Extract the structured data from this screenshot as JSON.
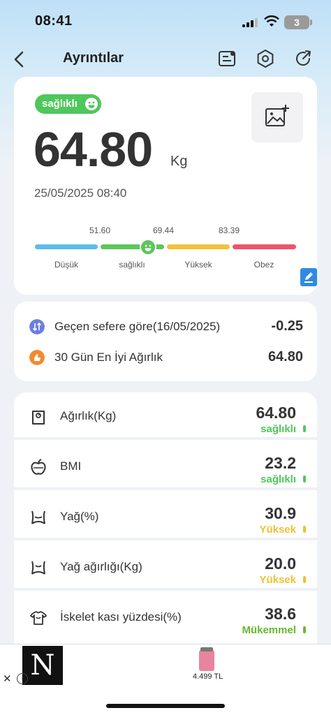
{
  "status_bar": {
    "time": "08:41",
    "battery": "3"
  },
  "nav": {
    "title": "Ayrıntılar"
  },
  "summary": {
    "badge": "sağlıklı",
    "weight": "64.80",
    "unit": "Kg",
    "datetime": "25/05/2025 08:40",
    "scale_numbers": [
      "51.60",
      "69.44",
      "83.39"
    ],
    "segments": [
      {
        "label": "Düşük",
        "color": "#5bbde8"
      },
      {
        "label": "sağlıklı",
        "color": "#5ec55a"
      },
      {
        "label": "Yüksek",
        "color": "#f3c23c"
      },
      {
        "label": "Obez",
        "color": "#ef5369"
      }
    ],
    "indicator_position": 0.62
  },
  "comparison": [
    {
      "label": "Geçen sefere göre(16/05/2025)",
      "value": "-0.25",
      "icon": "compare-arrows-icon",
      "color": "#6c7fe0"
    },
    {
      "label": "30 Gün En İyi Ağırlık",
      "value": "64.80",
      "icon": "thumbs-up-icon",
      "color": "#f38a2e"
    }
  ],
  "metrics": [
    {
      "label": "Ağırlık(Kg)",
      "value": "64.80",
      "status": "sağlıklı",
      "status_color": "#4fc75c",
      "icon": "scale-icon"
    },
    {
      "label": "BMI",
      "value": "23.2",
      "status": "sağlıklı",
      "status_color": "#4fc75c",
      "icon": "apple-icon"
    },
    {
      "label": "Yağ(%)",
      "value": "30.9",
      "status": "Yüksek",
      "status_color": "#f0bf33",
      "icon": "body-fat-icon"
    },
    {
      "label": "Yağ ağırlığı(Kg)",
      "value": "20.0",
      "status": "Yüksek",
      "status_color": "#f0bf33",
      "icon": "body-fat-weight-icon"
    },
    {
      "label": "İskelet kası yüzdesi(%)",
      "value": "38.6",
      "status": "Mükemmel",
      "status_color": "#66b82e",
      "icon": "muscle-icon"
    }
  ],
  "ad": {
    "logo": "N",
    "price": "4.499 TL"
  }
}
